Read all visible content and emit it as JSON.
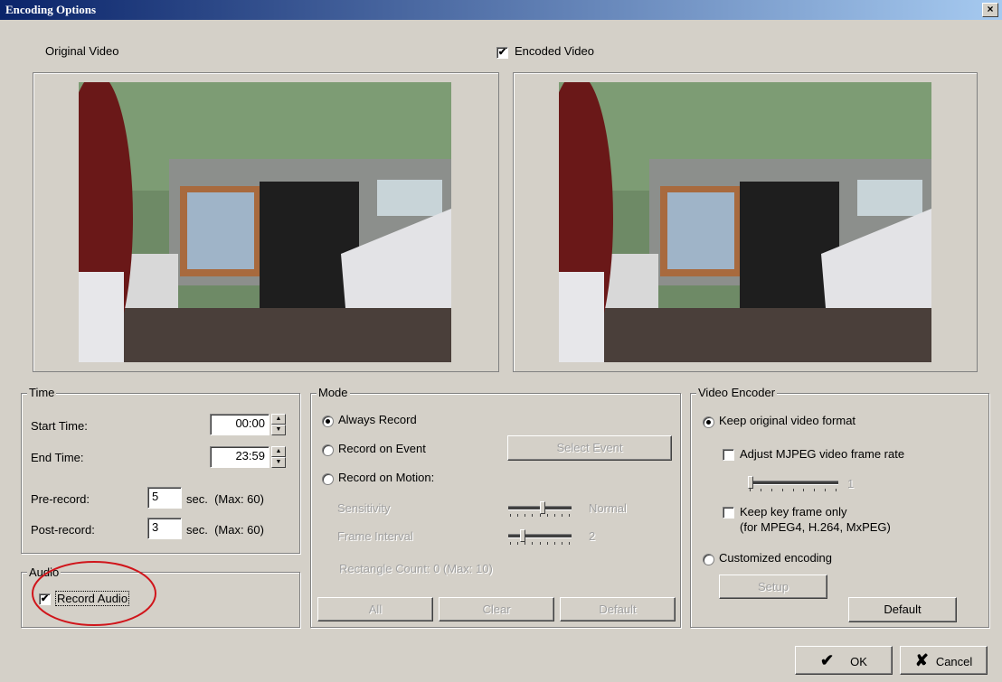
{
  "window": {
    "title": "Encoding Options",
    "close_label": "×"
  },
  "preview": {
    "original_label": "Original Video",
    "encoded_label": "Encoded Video",
    "encoded_checked": "✔"
  },
  "time": {
    "legend": "Time",
    "start_label": "Start Time:",
    "start_value": "00:00",
    "end_label": "End Time:",
    "end_value": "23:59",
    "pre_label": "Pre-record:",
    "pre_value": "5",
    "pre_unit": "sec.  (Max: 60)",
    "post_label": "Post-record:",
    "post_value": "3",
    "post_unit": "sec.  (Max: 60)"
  },
  "audio": {
    "legend": "Audio",
    "record_label": "Record Audio",
    "checked": "✔"
  },
  "mode": {
    "legend": "Mode",
    "always_label": "Always Record",
    "event_label": "Record on Event",
    "select_event_label": "Select Event",
    "motion_label": "Record on Motion:",
    "sensitivity_label": "Sensitivity",
    "sensitivity_value": "Normal",
    "sensitivity_level": 0.55,
    "frame_interval_label": "Frame Interval",
    "frame_interval_value": "2",
    "frame_interval_level": 0.2,
    "rect_count_label": "Rectangle Count: 0  (Max: 10)",
    "all_label": "All",
    "clear_label": "Clear",
    "default_label": "Default"
  },
  "encoder": {
    "legend": "Video Encoder",
    "keep_original_label": "Keep original video format",
    "adjust_label": "Adjust MJPEG video frame rate",
    "frame_rate_value": "1",
    "frame_rate_level": 0.0,
    "key_frame_label": "Keep key frame only",
    "key_frame_note": "(for MPEG4, H.264, MxPEG)",
    "customized_label": "Customized encoding",
    "setup_label": "Setup",
    "default_label": "Default"
  },
  "footer": {
    "ok_label": "OK",
    "cancel_label": "Cancel",
    "ok_icon": "✔",
    "cancel_icon": "✘"
  }
}
